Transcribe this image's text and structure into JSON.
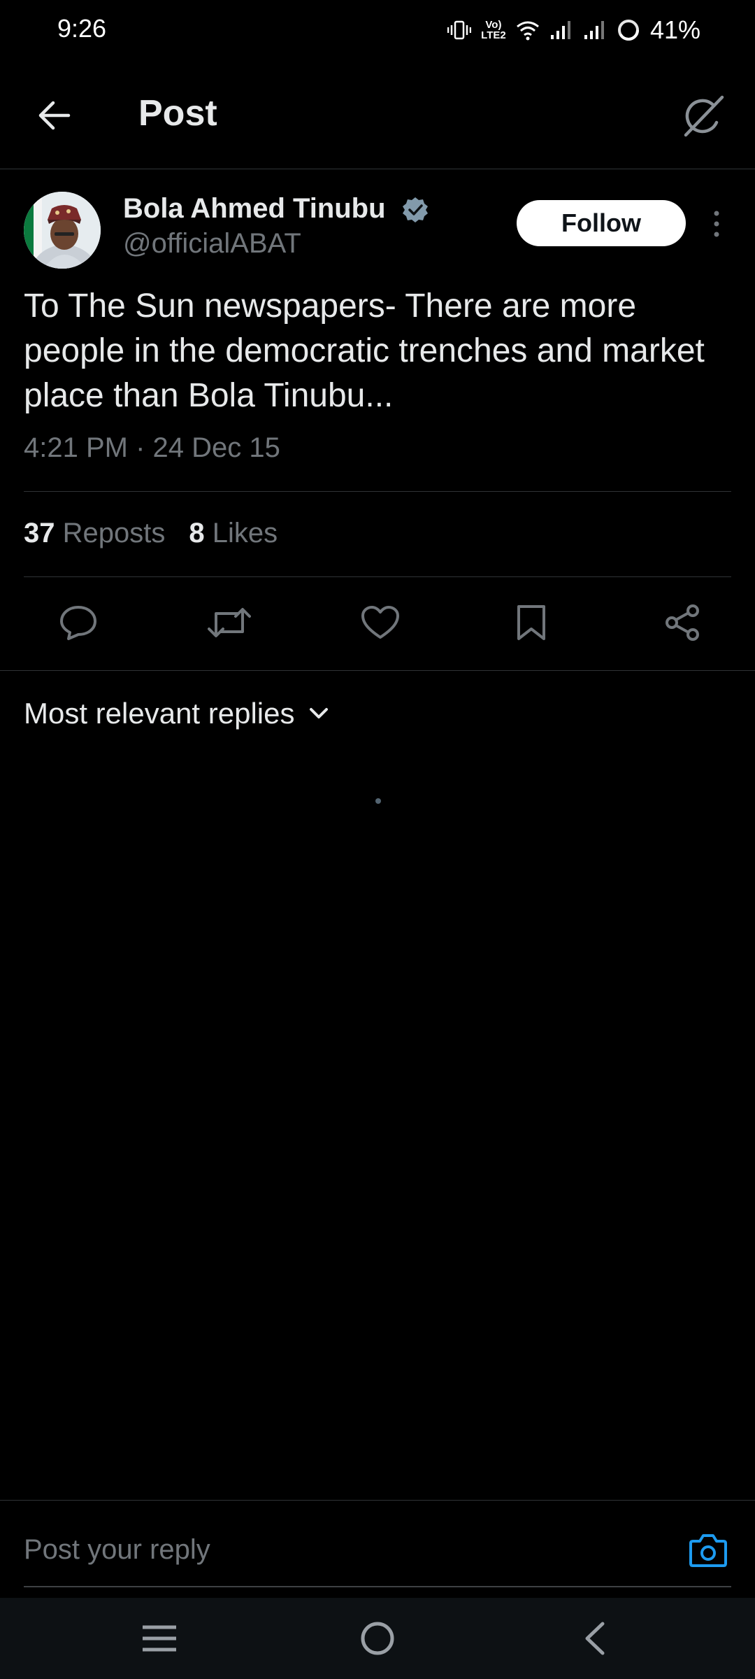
{
  "status_bar": {
    "time": "9:26",
    "battery": "41%",
    "network_label": "Vo) LTE2"
  },
  "header": {
    "title": "Post"
  },
  "post": {
    "author_name": "Bola Ahmed Tinubu",
    "author_handle": "@officialABAT",
    "follow_label": "Follow",
    "text": "To The Sun newspapers- There are more people in the democratic trenches and market place than Bola Tinubu...",
    "timestamp": "4:21 PM · 24 Dec 15",
    "reposts_count": "37",
    "reposts_label": "Reposts",
    "likes_count": "8",
    "likes_label": "Likes"
  },
  "replies": {
    "sort_label": "Most relevant replies"
  },
  "reply_bar": {
    "placeholder": "Post your reply"
  },
  "colors": {
    "background": "#000000",
    "text": "#e7e9ea",
    "muted": "#71767b",
    "accent": "#1d9bf0",
    "divider": "#2f3336"
  },
  "icons": [
    "back-arrow-icon",
    "grok-icon",
    "verified-badge-icon",
    "more-icon",
    "reply-icon",
    "repost-icon",
    "like-icon",
    "bookmark-icon",
    "share-icon",
    "chevron-down-icon",
    "camera-icon",
    "menu-icon",
    "home-icon",
    "nav-back-icon"
  ]
}
